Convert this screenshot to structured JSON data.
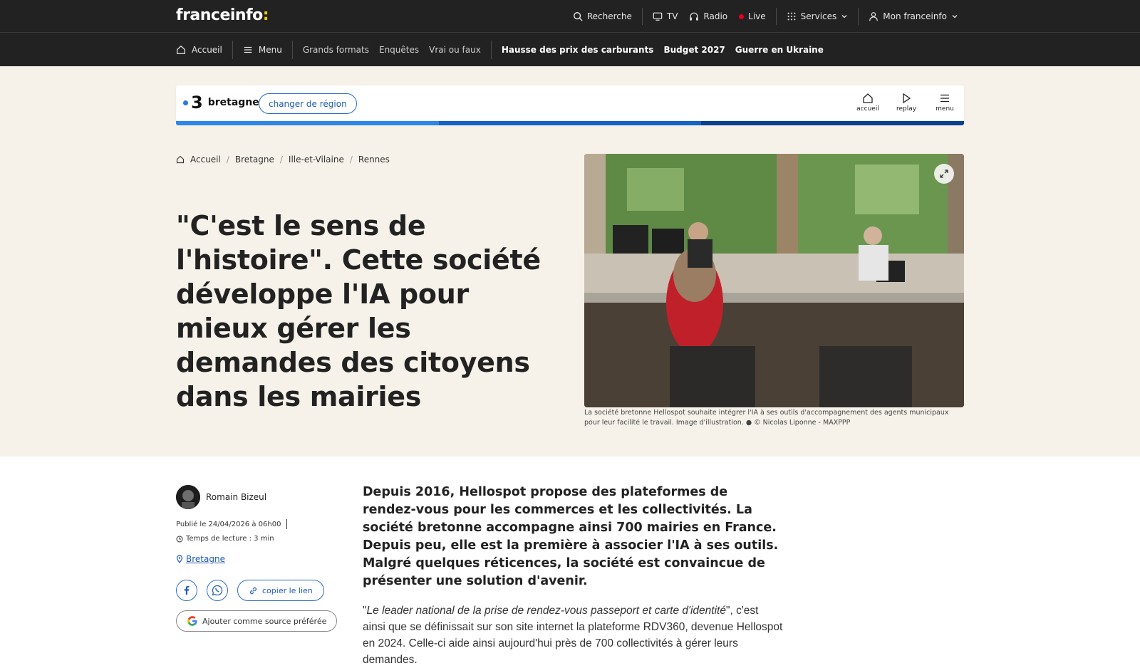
{
  "brand": {
    "logo_text": "franceinfo",
    "logo_colon": ":",
    "accent_color": "#f5c700"
  },
  "topnav": {
    "search": "Recherche",
    "tv": "TV",
    "radio": "Radio",
    "live": "Live",
    "services": "Services",
    "account": "Mon franceinfo"
  },
  "navbar": {
    "home": "Accueil",
    "menu": "Menu",
    "links": [
      "Grands formats",
      "Enquêtes",
      "Vrai ou faux"
    ],
    "hot_topics": [
      "Hausse des prix des carburants",
      "Budget 2027",
      "Guerre en Ukraine"
    ]
  },
  "region": {
    "number": "3",
    "name": "bretagne",
    "change_label": "changer de région",
    "icons": [
      {
        "label": "accueil",
        "icon": "home-icon"
      },
      {
        "label": "replay",
        "icon": "play-icon"
      },
      {
        "label": "menu",
        "icon": "hamburger-icon"
      }
    ],
    "strip_colors": [
      "#2f86e8",
      "#1462c2",
      "#0b3f8f"
    ]
  },
  "breadcrumb": [
    "Accueil",
    "Bretagne",
    "Ille-et-Vilaine",
    "Rennes"
  ],
  "article": {
    "title": "\"C'est le sens de l'histoire\". Cette société développe l'IA pour mieux gérer les demandes des citoyens dans les mairies",
    "caption": "La société bretonne Hellospot souhaite intégrer l'IA à ses outils d'accompagnement des agents municipaux pour leur facilité le travail. Image d'illustration. ● © Nicolas Liponne - MAXPPP",
    "author": "Romain Bizeul",
    "published": "Publié le 24/04/2026 à 06h00",
    "reading_time": "Temps de lecture : 3 min",
    "location": "Bretagne",
    "copy_link": "copier le lien",
    "google_source": "Ajouter comme source préférée",
    "lede": "Depuis 2016, Hellospot propose des plateformes de rendez-vous pour les commerces et les collectivités. La société bretonne accompagne ainsi 700 mairies en France. Depuis peu, elle est la première à associer l'IA à ses outils. Malgré quelques réticences, la société est convaincue de présenter une solution d'avenir.",
    "body_quote": "Le leader national de la prise de rendez-vous passeport et carte d'identité",
    "body_rest": ", c'est ainsi que se définissait sur son site internet la plateforme RDV360, devenue Hellospot en 2024. Celle-ci aide ainsi aujourd'hui près de 700 collectivités à gérer leurs demandes."
  }
}
